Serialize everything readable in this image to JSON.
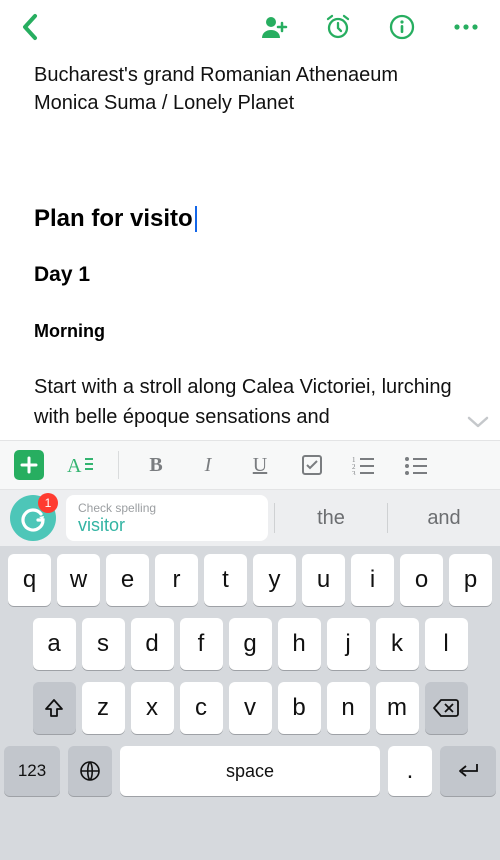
{
  "colors": {
    "accent": "#27ae60",
    "cursor": "#1366e8",
    "grammarly": "#4dc6b8",
    "badge": "#ff3b30"
  },
  "toolbar": {
    "icons": {
      "add_user": "add-user",
      "reminder": "alarm",
      "info": "info",
      "more": "more"
    }
  },
  "note": {
    "pre_line_1": "Bucharest's grand Romanian Athenaeum",
    "pre_line_2": "Monica Suma / Lonely Planet",
    "heading_editing": "Plan for visito",
    "day": "Day 1",
    "morning": "Morning",
    "paragraph": "Start with a stroll along Calea Victoriei, lurching with belle époque sensations and"
  },
  "formatbar": {
    "bold": "B",
    "italic": "I",
    "underline": "U"
  },
  "suggest": {
    "badge": "1",
    "label": "Check spelling",
    "primary": "visitor",
    "alt1": "the",
    "alt2": "and"
  },
  "keyboard": {
    "row1": [
      "q",
      "w",
      "e",
      "r",
      "t",
      "y",
      "u",
      "i",
      "o",
      "p"
    ],
    "row2": [
      "a",
      "s",
      "d",
      "f",
      "g",
      "h",
      "j",
      "k",
      "l"
    ],
    "row3": [
      "z",
      "x",
      "c",
      "v",
      "b",
      "n",
      "m"
    ],
    "numbers": "123",
    "space": "space",
    "dot": "."
  }
}
